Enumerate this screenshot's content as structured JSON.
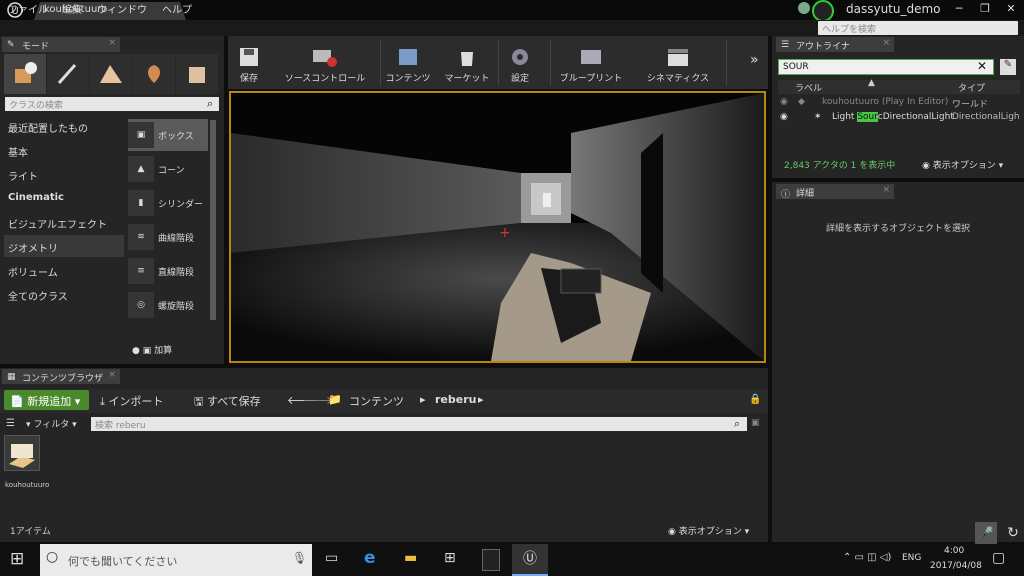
{
  "window": {
    "tab": "kouhoutuuro",
    "project": "dassyutu_demo",
    "buttons": [
      "─",
      "❐",
      "✕"
    ]
  },
  "menu": {
    "items": [
      "ファイル",
      "編集",
      "ウィンドウ",
      "ヘルプ"
    ],
    "help_placeholder": "ヘルプを検索"
  },
  "modes": {
    "tab": "モード",
    "search_placeholder": "クラスの検索",
    "categories": [
      "最近配置したもの",
      "基本",
      "ライト",
      "Cinematic",
      "ビジュアルエフェクト",
      "ジオメトリ",
      "ボリューム",
      "全てのクラス"
    ],
    "selected_category": "ジオメトリ",
    "primitives": [
      "ボックス",
      "コーン",
      "シリンダー",
      "曲線階段",
      "直線階段",
      "螺旋階段"
    ],
    "footer": "加算"
  },
  "toolbar": {
    "items": [
      "保存",
      "ソースコントロール",
      "コンテンツ",
      "マーケット",
      "設定",
      "ブループリント",
      "シネマティクス"
    ]
  },
  "outliner": {
    "tab": "アウトライナ",
    "search_value": "SOUR",
    "col_label": "ラベル",
    "col_type": "タイプ",
    "rows": [
      {
        "label": "kouhoutuuro (Play In Editor)",
        "type": "ワールド"
      },
      {
        "label_pre": "Light ",
        "label_hl": "Sour",
        "label_post": "cDirectionalLight",
        "type": "DirectionalLigh"
      }
    ],
    "status": "2,843 アクタの 1 を表示中",
    "view_options": "表示オプション"
  },
  "details": {
    "tab": "詳細",
    "empty": "詳細を表示するオブジェクトを選択"
  },
  "content": {
    "tab": "コンテンツブラウザ",
    "new": "新規追加",
    "import": "インポート",
    "save_all": "すべて保存",
    "path": [
      "コンテンツ",
      "reberu"
    ],
    "filter": "フィルタ",
    "search_placeholder": "検索 reberu",
    "asset": "kouhoutuuro",
    "count": "1アイテム",
    "view_options": "表示オプション"
  },
  "taskbar": {
    "search": "何でも聞いてください",
    "lang": "ENG",
    "time": "4:00",
    "date": "2017/04/08"
  },
  "colors": {
    "accent": "#b8860b",
    "new_button": "#4b8a2c",
    "highlight": "#46c846"
  }
}
